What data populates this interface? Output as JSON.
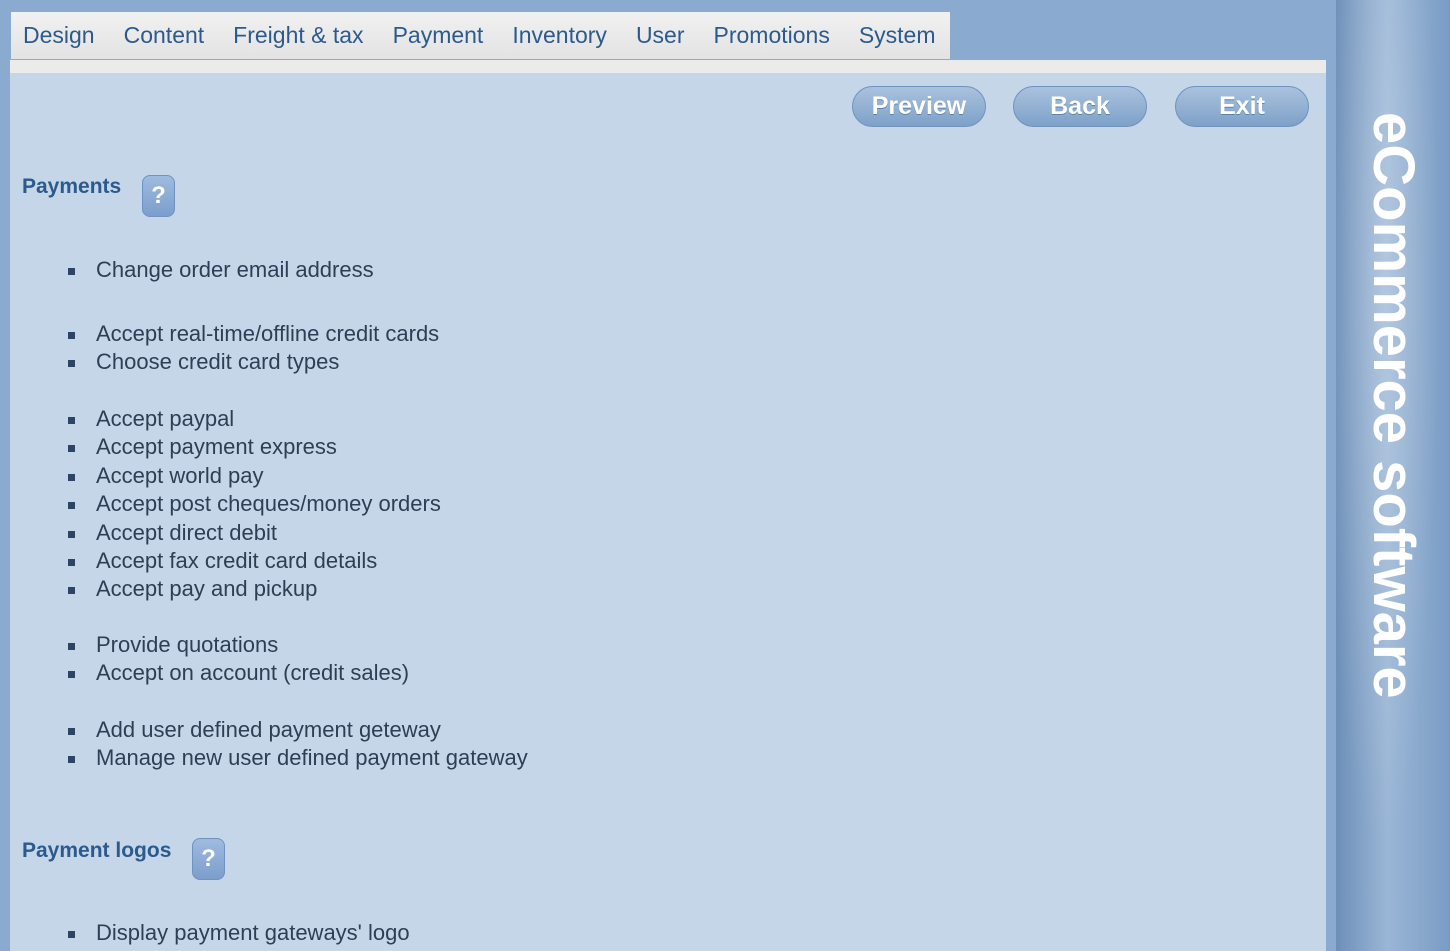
{
  "nav": {
    "items": [
      "Design",
      "Content",
      "Freight & tax",
      "Payment",
      "Inventory",
      "User",
      "Promotions",
      "System"
    ]
  },
  "toolbar": {
    "preview_label": "Preview",
    "back_label": "Back",
    "exit_label": "Exit"
  },
  "sidebar": {
    "brand": "eCommerce software"
  },
  "sections": {
    "payments": {
      "title": "Payments",
      "help": "?",
      "group1": [
        "Change order email address"
      ],
      "group2": [
        "Accept real-time/offline credit cards",
        "Choose credit card types"
      ],
      "group3": [
        "Accept paypal",
        "Accept payment express",
        "Accept world pay",
        "Accept post cheques/money orders",
        "Accept direct debit",
        "Accept fax credit card details",
        "Accept pay and pickup"
      ],
      "group4": [
        "Provide quotations",
        "Accept on account (credit sales)"
      ],
      "group5": [
        "Add user defined payment geteway",
        "Manage new user defined payment gateway"
      ]
    },
    "payment_logos": {
      "title": "Payment logos",
      "help": "?",
      "group1": [
        "Display payment gateways' logo"
      ]
    }
  }
}
